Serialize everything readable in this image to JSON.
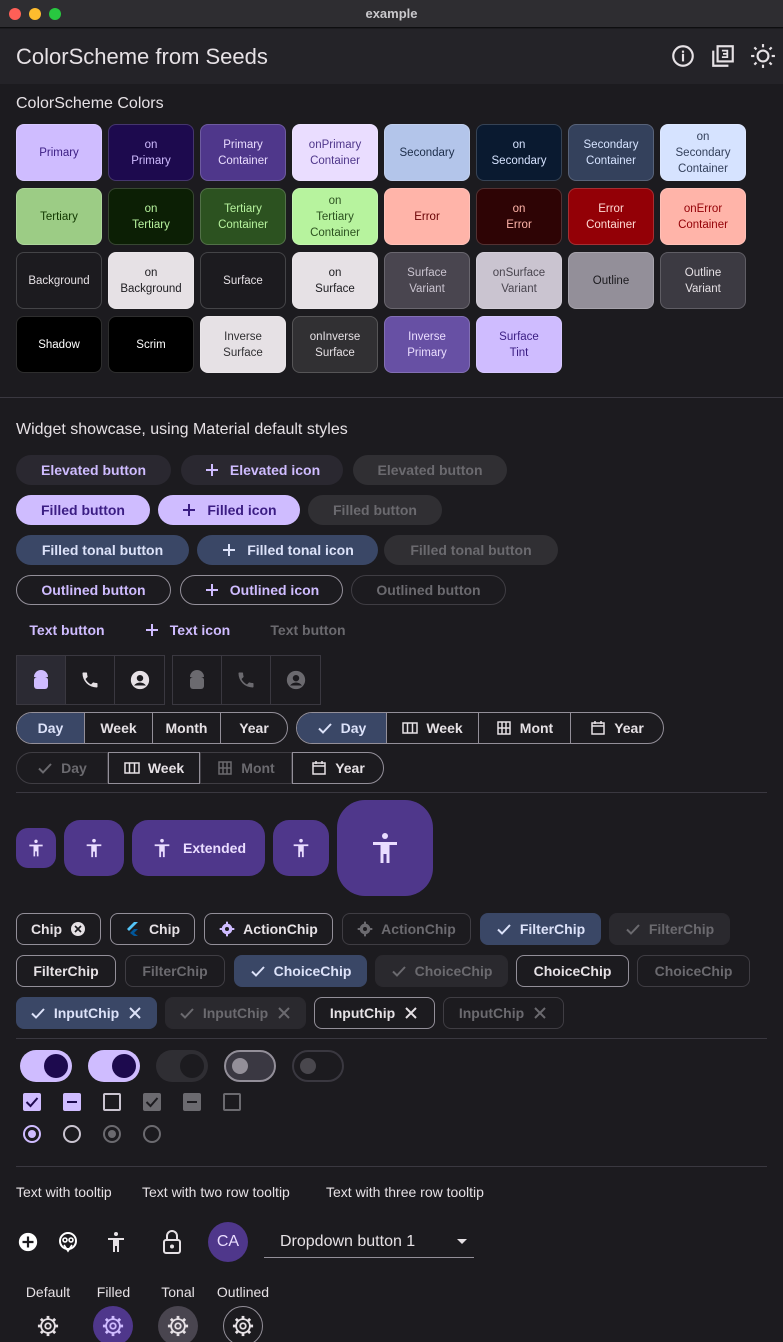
{
  "window": {
    "title": "example"
  },
  "appbar": {
    "title": "ColorScheme from Seeds",
    "icons": [
      "info-icon",
      "filter-3-icon",
      "brightness-icon"
    ]
  },
  "colors_section": {
    "title": "ColorScheme Colors"
  },
  "tiles": [
    {
      "label": "Primary",
      "bg": "#cfbcff",
      "fg": "#3b1d83"
    },
    {
      "label": "on\nPrimary",
      "bg": "#1d0a4e",
      "fg": "#cfbcff"
    },
    {
      "label": "Primary\nContainer",
      "bg": "#4f378b",
      "fg": "#eaddff"
    },
    {
      "label": "onPrimary\nContainer",
      "bg": "#eaddff",
      "fg": "#4f378b"
    },
    {
      "label": "Secondary",
      "bg": "#b3c5ea",
      "fg": "#1c2d4a"
    },
    {
      "label": "on\nSecondary",
      "bg": "#0a1a30",
      "fg": "#d6e3ff"
    },
    {
      "label": "Secondary\nContainer",
      "bg": "#34415c",
      "fg": "#d6e3ff"
    },
    {
      "label": "on\nSecondary\nContainer",
      "bg": "#d6e3ff",
      "fg": "#34415c"
    },
    {
      "label": "Tertiary",
      "bg": "#9ccc85",
      "fg": "#113800"
    },
    {
      "label": "on\nTertiary",
      "bg": "#0c1f05",
      "fg": "#b7f39e"
    },
    {
      "label": "Tertiary\nContainer",
      "bg": "#2c5220",
      "fg": "#b7f39e"
    },
    {
      "label": "on\nTertiary\nContainer",
      "bg": "#b7f39e",
      "fg": "#2c5220"
    },
    {
      "label": "Error",
      "bg": "#ffb4a9",
      "fg": "#680003"
    },
    {
      "label": "on\nError",
      "bg": "#2e0405",
      "fg": "#ffb4a9"
    },
    {
      "label": "Error\nContainer",
      "bg": "#930006",
      "fg": "#ffdad4"
    },
    {
      "label": "onError\nContainer",
      "bg": "#ffb4a9",
      "fg": "#930006"
    },
    {
      "label": "Background",
      "bg": "#1c1b1f",
      "fg": "#e6e1e5"
    },
    {
      "label": "on\nBackground",
      "bg": "#e6e1e5",
      "fg": "#1c1b1f"
    },
    {
      "label": "Surface",
      "bg": "#1c1b1f",
      "fg": "#e6e1e5"
    },
    {
      "label": "on\nSurface",
      "bg": "#e6e1e5",
      "fg": "#1c1b1f"
    },
    {
      "label": "Surface\nVariant",
      "bg": "#49454f",
      "fg": "#cac4d0"
    },
    {
      "label": "onSurface\nVariant",
      "bg": "#cac4d0",
      "fg": "#49454f"
    },
    {
      "label": "Outline",
      "bg": "#938f99",
      "fg": "#1c1b1f"
    },
    {
      "label": "Outline\nVariant",
      "bg": "#3c3a42",
      "fg": "#e6e1e5"
    },
    {
      "label": "Shadow",
      "bg": "#000000",
      "fg": "#ffffff"
    },
    {
      "label": "Scrim",
      "bg": "#000000",
      "fg": "#ffffff"
    },
    {
      "label": "Inverse\nSurface",
      "bg": "#e6e1e5",
      "fg": "#313033"
    },
    {
      "label": "onInverse\nSurface",
      "bg": "#313033",
      "fg": "#e6e1e5"
    },
    {
      "label": "Inverse\nPrimary",
      "bg": "#6750a4",
      "fg": "#eaddff"
    },
    {
      "label": "Surface\nTint",
      "bg": "#cfbcff",
      "fg": "#3b1d83"
    }
  ],
  "widgets_section": {
    "title": "Widget showcase, using Material default styles"
  },
  "buttons": {
    "elevated": "Elevated button",
    "elevated_icon": "Elevated icon",
    "elevated_disabled": "Elevated button",
    "filled": "Filled button",
    "filled_icon": "Filled icon",
    "filled_disabled": "Filled button",
    "tonal": "Filled tonal button",
    "tonal_icon": "Filled tonal icon",
    "tonal_disabled": "Filled tonal button",
    "outlined": "Outlined button",
    "outlined_icon": "Outlined icon",
    "outlined_disabled": "Outlined button",
    "text": "Text button",
    "text_icon": "Text icon",
    "text_disabled": "Text button"
  },
  "segmented1": [
    "Day",
    "Week",
    "Month",
    "Year"
  ],
  "segmented2": [
    "Day",
    "Week",
    "Mont",
    "Year"
  ],
  "segmented3": [
    "Day",
    "Week",
    "Mont",
    "Year"
  ],
  "fab": {
    "extended_label": "Extended"
  },
  "chips": {
    "row1": [
      "Chip",
      "Chip",
      "ActionChip",
      "ActionChip",
      "FilterChip",
      "FilterChip"
    ],
    "row2": [
      "FilterChip",
      "FilterChip",
      "ChoiceChip",
      "ChoiceChip",
      "ChoiceChip",
      "ChoiceChip"
    ],
    "row3": [
      "InputChip",
      "InputChip",
      "InputChip",
      "InputChip"
    ]
  },
  "tooltips": [
    "Text with tooltip",
    "Text with two row tooltip",
    "Text with three row tooltip"
  ],
  "avatar": {
    "initials": "CA"
  },
  "dropdown": {
    "value": "Dropdown button 1"
  },
  "icon_buttons": {
    "labels": [
      "Default",
      "Filled",
      "Tonal",
      "Outlined"
    ]
  }
}
